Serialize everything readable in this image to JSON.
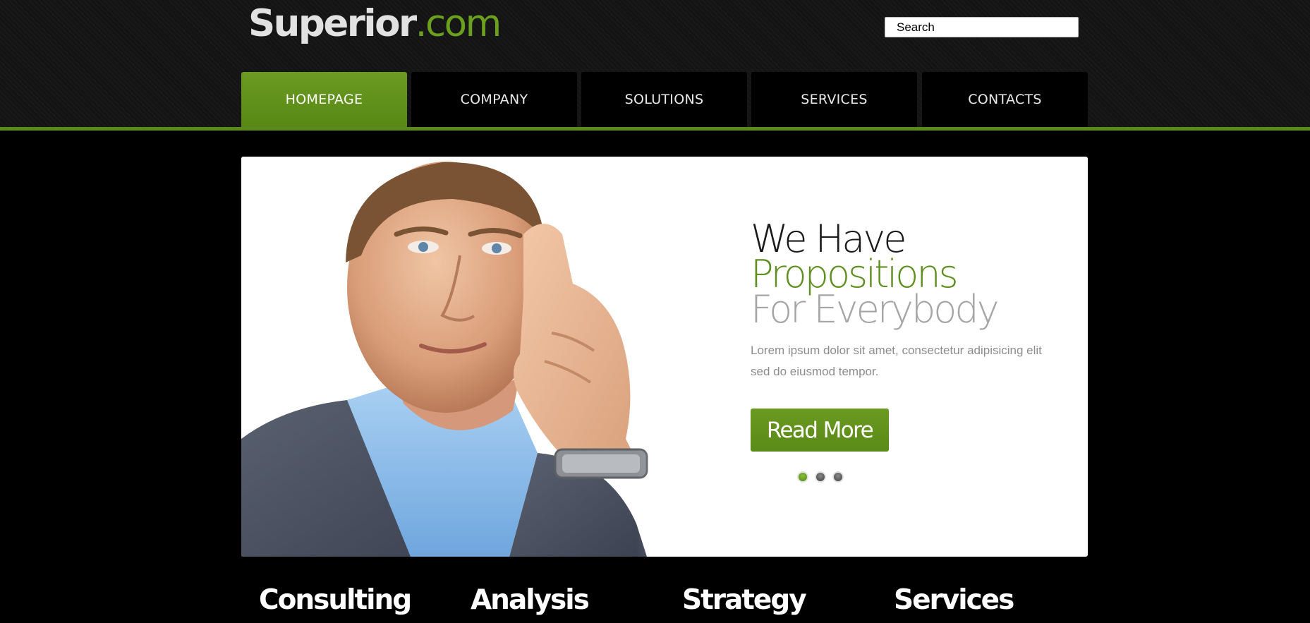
{
  "header": {
    "logo_main": "Superior",
    "logo_tld": ".com",
    "search_placeholder": "Search"
  },
  "nav": {
    "items": [
      {
        "label": "HOMEPAGE",
        "active": true
      },
      {
        "label": "COMPANY",
        "active": false
      },
      {
        "label": "SOLUTIONS",
        "active": false
      },
      {
        "label": "SERVICES",
        "active": false
      },
      {
        "label": "CONTACTS",
        "active": false
      }
    ]
  },
  "hero": {
    "line1": "We Have",
    "line2": "Propositions",
    "line3": "For Everybody",
    "body": "Lorem ipsum dolor sit amet, consectetur adipisicing elit sed do eiusmod tempor.",
    "button_label": "Read More",
    "slide_count": 3,
    "active_slide": 1
  },
  "features": {
    "items": [
      "Consulting",
      "Analysis",
      "Strategy",
      "Services"
    ]
  },
  "colors": {
    "accent_green": "#5f8f1e",
    "background": "#000000"
  }
}
